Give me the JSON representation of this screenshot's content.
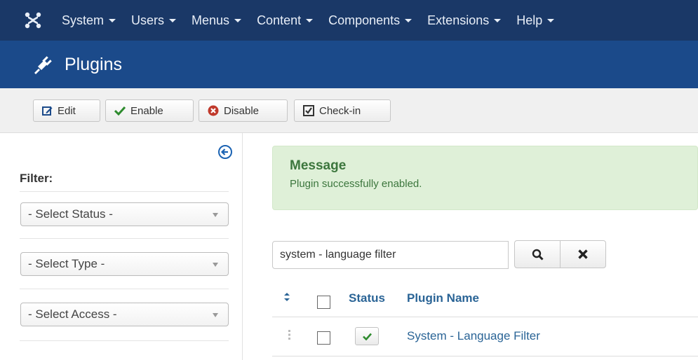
{
  "topnav": {
    "items": [
      {
        "label": "System"
      },
      {
        "label": "Users"
      },
      {
        "label": "Menus"
      },
      {
        "label": "Content"
      },
      {
        "label": "Components"
      },
      {
        "label": "Extensions"
      },
      {
        "label": "Help"
      }
    ]
  },
  "titlebar": {
    "title": "Plugins",
    "icon": "plug-icon"
  },
  "toolbar": {
    "edit_label": "Edit",
    "enable_label": "Enable",
    "disable_label": "Disable",
    "checkin_label": "Check-in"
  },
  "sidebar": {
    "filter_label": "Filter:",
    "status_select": "- Select Status -",
    "type_select": "- Select Type -",
    "access_select": "- Select Access -"
  },
  "message": {
    "title": "Message",
    "text": "Plugin successfully enabled."
  },
  "search": {
    "value": "system - language filter"
  },
  "table": {
    "headers": {
      "status": "Status",
      "plugin_name": "Plugin Name"
    },
    "rows": [
      {
        "status": "enabled",
        "name": "System - Language Filter"
      }
    ]
  },
  "colors": {
    "topnav_bg": "#1a3867",
    "titlebar_bg": "#1b4a8a",
    "message_bg": "#dff0d8",
    "message_text": "#3c763d",
    "link": "#2a6496",
    "enable_green": "#2e8b2e",
    "disable_red": "#c0392b"
  }
}
